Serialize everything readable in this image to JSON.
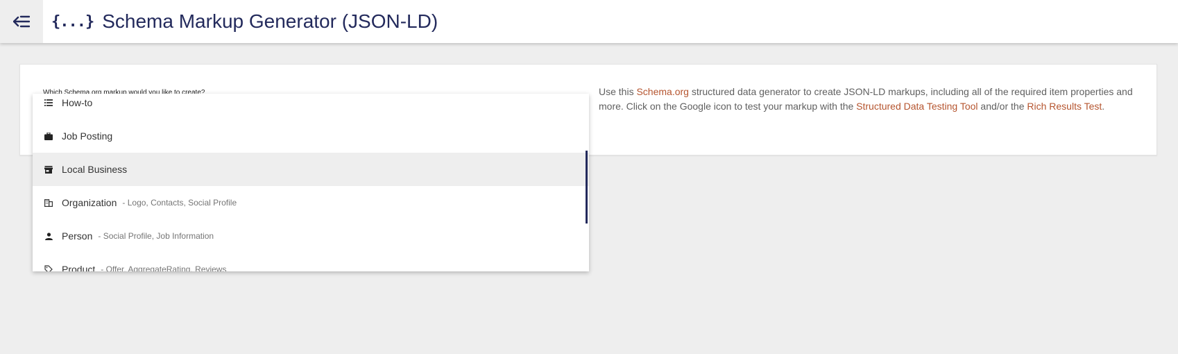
{
  "header": {
    "title": "Schema Markup Generator (JSON-LD)",
    "menu_icon": "collapse-menu-icon",
    "logo_icon": "braces-icon",
    "accent_color": "#232a5c"
  },
  "form": {
    "question_label": "Which Schema.org markup would you like to create?"
  },
  "description": {
    "text_1": "Use this ",
    "link_schema": "Schema.org",
    "text_2": " structured data generator to create JSON-LD markups, including all of the required item properties and more. Click on the Google icon to test your markup with the ",
    "link_sdtt": "Structured Data Testing Tool",
    "text_3": " and/or the ",
    "link_rrt": "Rich Results Test",
    "text_4": ".",
    "link_color": "#b5542e"
  },
  "dropdown": {
    "items": [
      {
        "label": "How-to",
        "sub": "",
        "icon": "list-icon"
      },
      {
        "label": "Job Posting",
        "sub": "",
        "icon": "briefcase-icon"
      },
      {
        "label": "Local Business",
        "sub": "",
        "icon": "store-icon",
        "highlighted": true
      },
      {
        "label": "Organization",
        "sub": "- Logo, Contacts, Social Profile",
        "icon": "building-icon"
      },
      {
        "label": "Person",
        "sub": "- Social Profile, Job Information",
        "icon": "person-icon"
      },
      {
        "label": "Product",
        "sub": "- Offer, AggregateRating, Reviews",
        "icon": "tag-icon"
      }
    ]
  }
}
